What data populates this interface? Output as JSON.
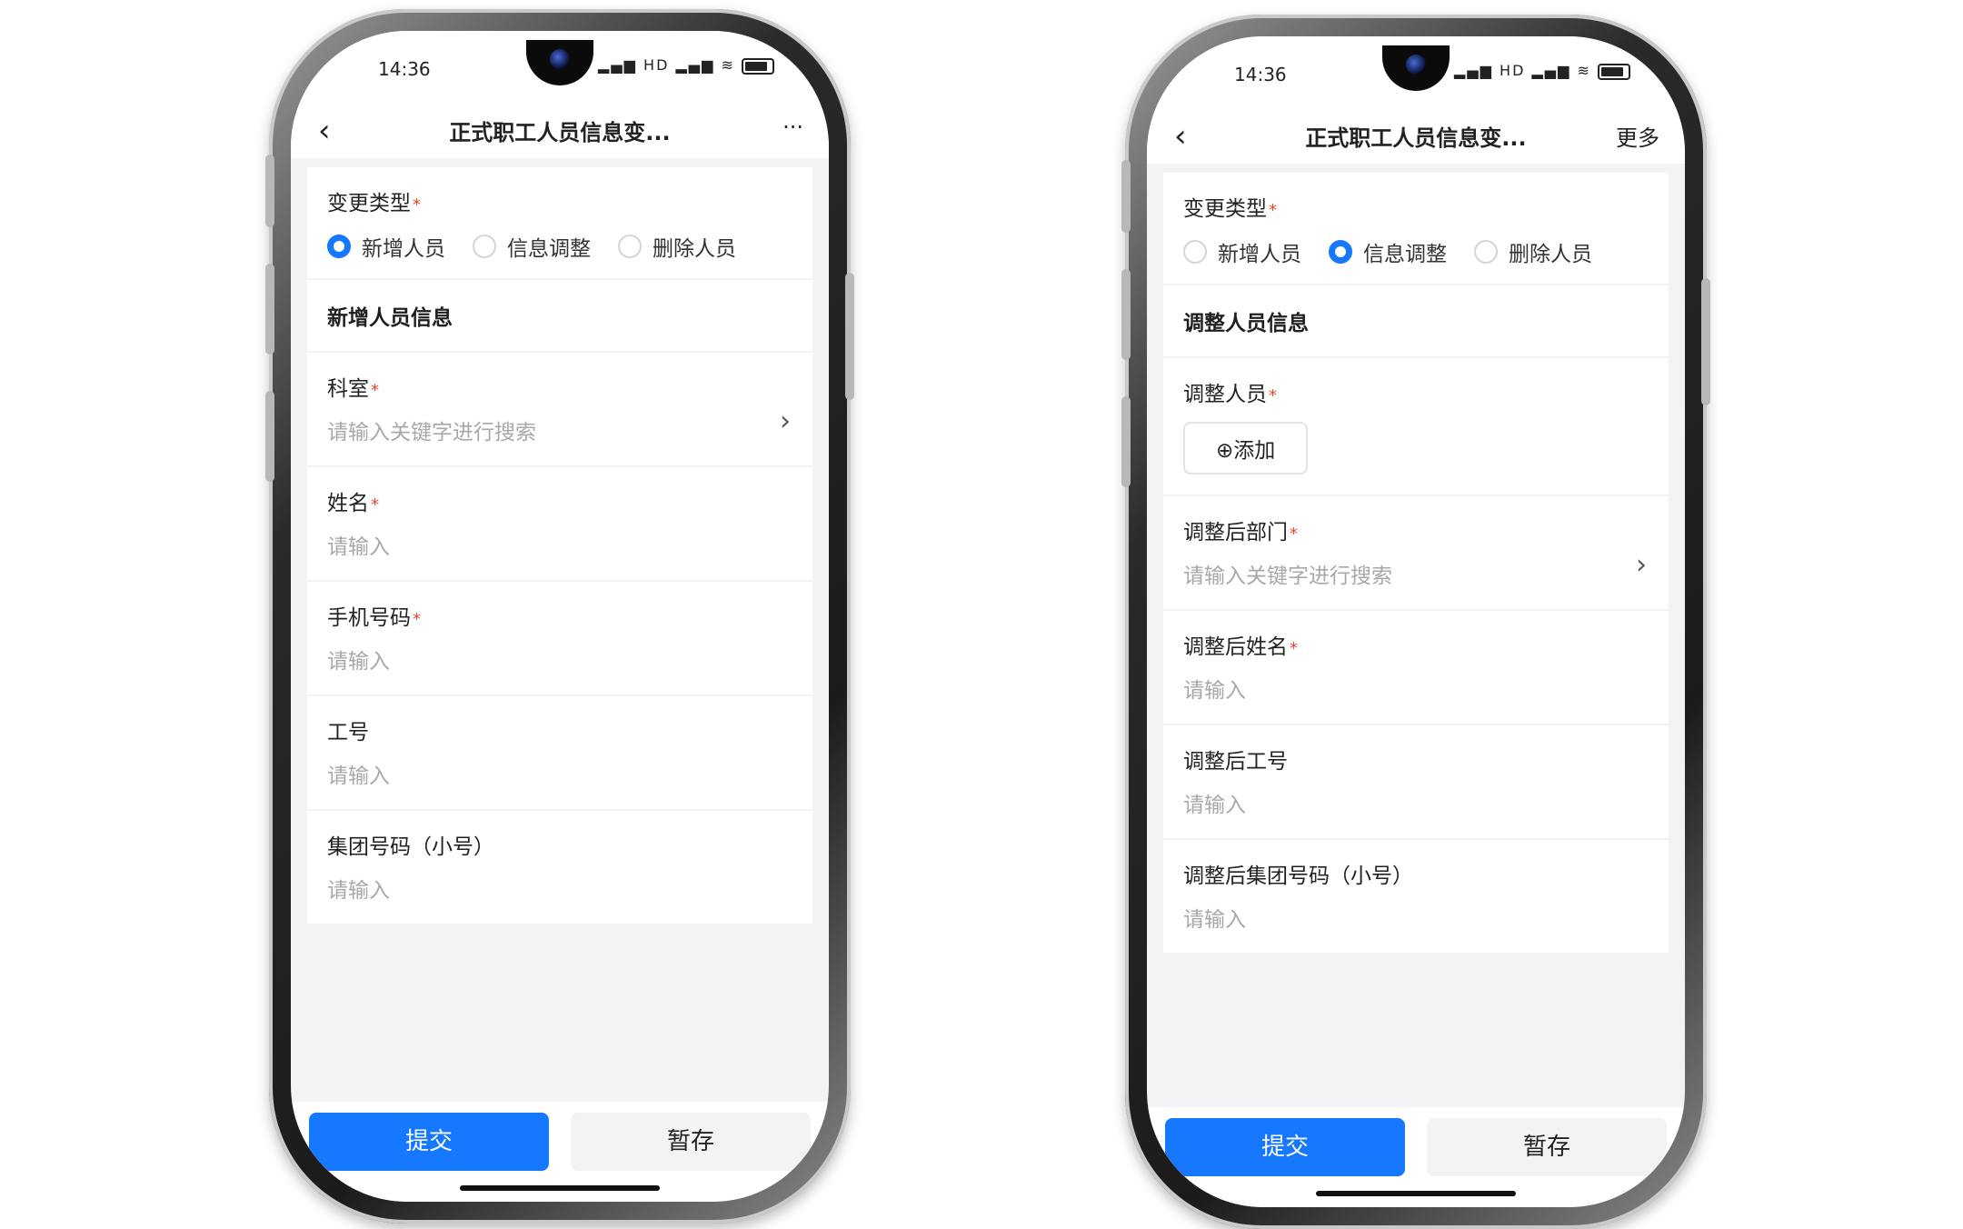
{
  "left_phone": {
    "time": "14:36",
    "status_icons": "✕ HD ▂▄▆ HD ▂▄▆ ≋",
    "title": "正式职工人员信息变...",
    "more": "···",
    "change_type_label": "变更类型",
    "radios": [
      "新增人员",
      "信息调整",
      "删除人员"
    ],
    "section_title": "新增人员信息",
    "fields": [
      {
        "label": "科室",
        "placeholder": "请输入关键字进行搜索"
      },
      {
        "label": "姓名",
        "placeholder": "请输入"
      },
      {
        "label": "手机号码",
        "placeholder": "请输入"
      },
      {
        "label": "工号",
        "placeholder": "请输入"
      },
      {
        "label": "集团号码（小号）",
        "placeholder": "请输入"
      }
    ],
    "submit": "提交",
    "save": "暂存"
  },
  "right_phone": {
    "time": "14:36",
    "status_icons": "✕ HD ▂▄▆ HD ▂▄▆ ≋",
    "title": "正式职工人员信息变...",
    "more": "更多",
    "change_type_label": "变更类型",
    "radios": [
      "新增人员",
      "信息调整",
      "删除人员"
    ],
    "section_title": "调整人员信息",
    "adjust_person_label": "调整人员",
    "add_button": "⊕添加",
    "fields": [
      {
        "label": "调整后部门",
        "placeholder": "请输入关键字进行搜索"
      },
      {
        "label": "调整后姓名",
        "placeholder": "请输入"
      },
      {
        "label": "调整后工号",
        "placeholder": "请输入"
      },
      {
        "label": "调整后集团号码（小号）",
        "placeholder": "请输入"
      }
    ],
    "submit": "提交",
    "save": "暂存"
  },
  "selected_radio": {
    "left": "新增人员",
    "right": "信息调整"
  },
  "colors": {
    "accent": "#1677ff",
    "required": "#e8472d",
    "placeholder": "#a8a8a8"
  }
}
